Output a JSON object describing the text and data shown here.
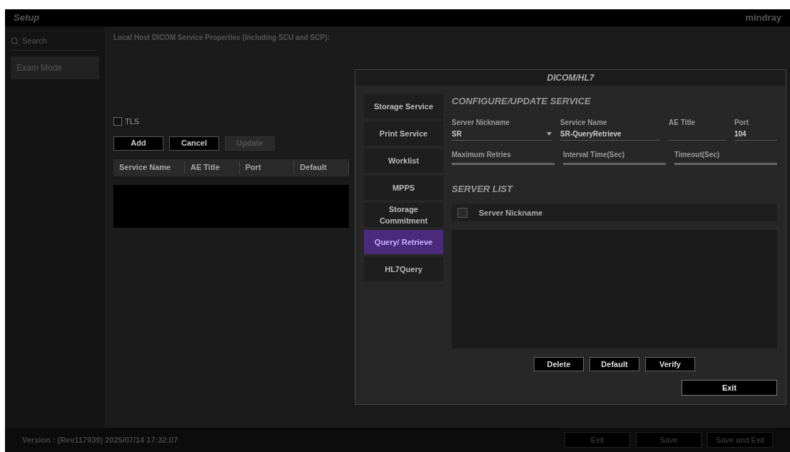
{
  "window": {
    "title": "Setup",
    "brand": "mindray"
  },
  "sidebar": {
    "search": {
      "placeholder": "Search"
    },
    "items": [
      {
        "label": "Exam Mode",
        "selected": false
      }
    ]
  },
  "main": {
    "title": "Local Host DICOM Service Properties (Including SCU and SCP):",
    "tls": {
      "label": "TLS",
      "checked": false
    },
    "buttons": [
      {
        "label": "Add",
        "disabled": false
      },
      {
        "label": "Cancel",
        "disabled": false
      },
      {
        "label": "Update",
        "disabled": true
      }
    ],
    "table": {
      "columns": [
        "Service Name",
        "AE Title",
        "Port",
        "Default"
      ]
    }
  },
  "dialog": {
    "title": "DICOM/HL7",
    "services": [
      {
        "label": "Storage Service",
        "selected": false
      },
      {
        "label": "Print Service",
        "selected": false
      },
      {
        "label": "Worklist",
        "selected": false
      },
      {
        "label": "MPPS",
        "selected": false
      },
      {
        "label": "Storage Commitment",
        "selected": false
      },
      {
        "label": "Query/ Retrieve",
        "selected": true
      },
      {
        "label": "HL7Query",
        "selected": false
      }
    ],
    "configure": {
      "heading": "CONFIGURE/UPDATE SERVICE",
      "fields": [
        {
          "label": "Server Nickname",
          "value": "SR",
          "kind": "dropdown"
        },
        {
          "label": "Service Name",
          "value": "SR-QueryRetrieve",
          "kind": "text"
        },
        {
          "label": "AE Title",
          "kind": "text"
        },
        {
          "label": "Port",
          "value": "104",
          "kind": "text"
        }
      ],
      "sliders": [
        {
          "label": "Maximum Retries"
        },
        {
          "label": "Interval Time(Sec)"
        },
        {
          "label": "Timeout(Sec)"
        }
      ]
    },
    "server_list": {
      "heading": "SERVER LIST",
      "select_all": {
        "checked": false
      },
      "columns": [
        "Server Nickname"
      ]
    },
    "buttons": [
      "Delete",
      "Default",
      "Verify"
    ],
    "exit": "Exit"
  },
  "footer": {
    "version": "Version : (Rev117939) 2025/07/14 17:32:07",
    "buttons": [
      "Exit",
      "Save",
      "Save and Exit"
    ]
  }
}
